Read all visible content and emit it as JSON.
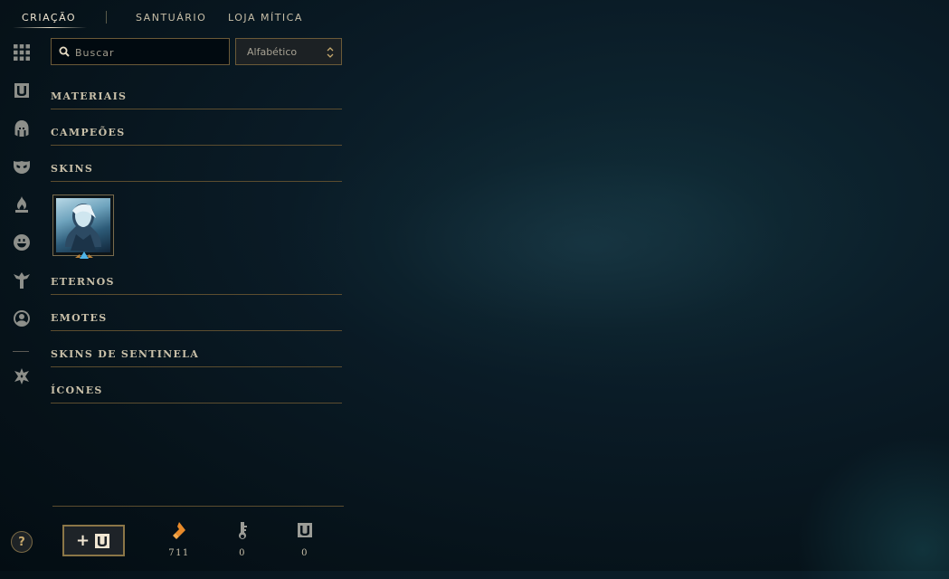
{
  "nav": {
    "tabs": [
      {
        "label": "CRIAÇÃO",
        "active": true
      },
      {
        "label": "SANTUÁRIO",
        "active": false
      },
      {
        "label": "LOJA MÍTICA",
        "active": false
      }
    ]
  },
  "rail": {
    "icons": [
      "grid-icon",
      "chest-icon",
      "helmet-icon",
      "mask-icon",
      "flame-icon",
      "emote-face-icon",
      "ward-icon",
      "profile-icon",
      "eternal-icon"
    ],
    "help_label": "?"
  },
  "search": {
    "placeholder": "Buscar",
    "value": ""
  },
  "sort": {
    "selected": "Alfabético"
  },
  "categories": [
    {
      "label": "MATERIAIS"
    },
    {
      "label": "CAMPEÕES"
    },
    {
      "label": "SKINS"
    },
    {
      "label": "ETERNOS"
    },
    {
      "label": "EMOTES"
    },
    {
      "label": "SKINS DE SENTINELA"
    },
    {
      "label": "ÍCONES"
    }
  ],
  "skins": {
    "items": [
      {
        "champion_art": "skin-portrait",
        "rarity_color": "#4fb4e8"
      }
    ]
  },
  "bottom": {
    "craft_button_label": "+",
    "resources": [
      {
        "icon": "orange-essence-icon",
        "count": "711"
      },
      {
        "icon": "key-icon",
        "count": "0"
      },
      {
        "icon": "chest-icon",
        "count": "0"
      }
    ]
  },
  "colors": {
    "gold": "#c8aa6e",
    "accent_orange": "#e88a2a",
    "rarity_blue": "#4fb4e8"
  }
}
